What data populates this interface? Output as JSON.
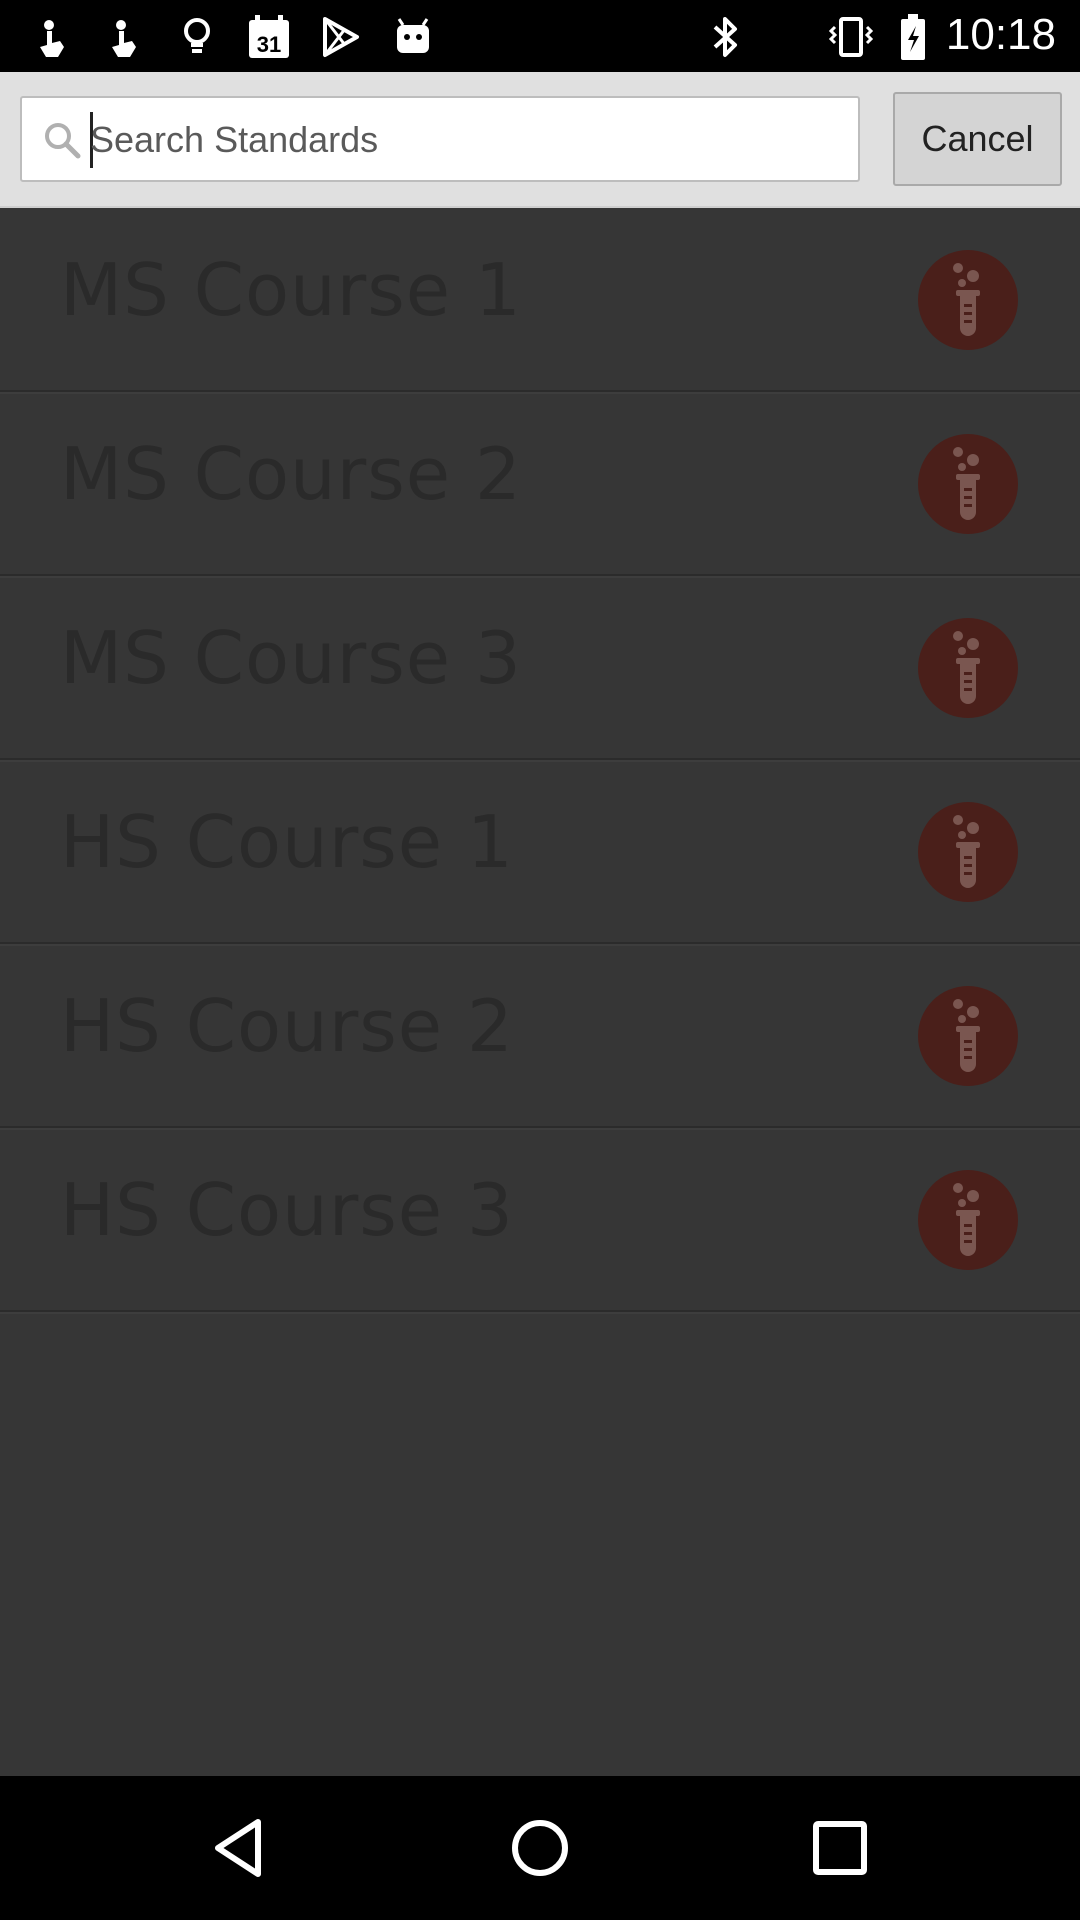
{
  "status_bar": {
    "time": "10:18",
    "calendar_date": "31",
    "left_icons": [
      "touch-icon",
      "touch-icon",
      "lightbulb-icon",
      "calendar-icon",
      "play-store-icon",
      "android-icon"
    ],
    "right_icons": [
      "bluetooth-icon",
      "vibrate-icon",
      "battery-icon"
    ]
  },
  "search": {
    "placeholder": "Search Standards",
    "value": "",
    "cancel_label": "Cancel"
  },
  "list": {
    "items": [
      {
        "label": "MS Course 1",
        "icon": "test-tube-icon"
      },
      {
        "label": "MS Course 2",
        "icon": "test-tube-icon"
      },
      {
        "label": "MS Course 3",
        "icon": "test-tube-icon"
      },
      {
        "label": "HS Course 1",
        "icon": "test-tube-icon"
      },
      {
        "label": "HS Course 2",
        "icon": "test-tube-icon"
      },
      {
        "label": "HS Course 3",
        "icon": "test-tube-icon"
      }
    ]
  },
  "nav_bar": {
    "buttons": [
      "back-icon",
      "home-icon",
      "recents-icon"
    ]
  },
  "colors": {
    "list_background": "#363636",
    "list_text": "#2a2a2a",
    "icon_circle": "#4a1f1a",
    "icon_glyph": "#7a5650",
    "header_background": "#e0e0e0"
  }
}
